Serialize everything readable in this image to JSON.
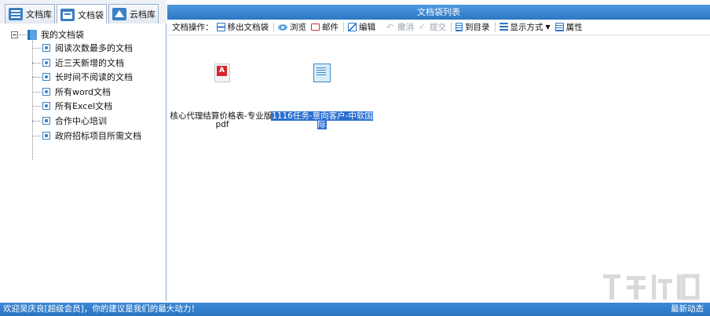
{
  "tabs": [
    {
      "label": "文档库",
      "icon": "list-icon",
      "active": false
    },
    {
      "label": "文档袋",
      "icon": "folder-icon",
      "active": true
    },
    {
      "label": "云档库",
      "icon": "cloud-icon",
      "active": false
    }
  ],
  "tree": {
    "root": "我的文档袋",
    "items": [
      {
        "label": "阅读次数最多的文档",
        "icon": "view-node-icon"
      },
      {
        "label": "近三天新增的文档",
        "icon": "view-node-icon"
      },
      {
        "label": "长时间不阅读的文档",
        "icon": "view-node-icon"
      },
      {
        "label": "所有word文档",
        "icon": "view-node-icon"
      },
      {
        "label": "所有Excel文档",
        "icon": "view-node-icon"
      },
      {
        "label": "合作中心培训",
        "icon": "person-node-icon"
      },
      {
        "label": "政府招标项目所需文档",
        "icon": "person-node-icon"
      }
    ]
  },
  "panel": {
    "title": "文档袋列表"
  },
  "toolbar": {
    "prefix": "文档操作：",
    "move_out": "移出文档袋",
    "browse": "浏览",
    "mail": "邮件",
    "edit": "编辑",
    "cancel": "撤消",
    "submit": "提交",
    "to_dir": "到目录",
    "display_mode": "显示方式",
    "properties": "属性"
  },
  "files": [
    {
      "name_line1": "核心代理结算价格表-专业版.",
      "name_line2": "pdf",
      "type": "pdf",
      "selected": false
    },
    {
      "name_line1": "1116任务-意向客户-中软国际",
      "name_line2": "",
      "type": "excel",
      "selected": true
    }
  ],
  "status": {
    "left": "欢迎吴庆良[超级会员]，你的建议是我们的最大动力！",
    "right": "最新动态"
  },
  "colors": {
    "accent": "#2c77c4",
    "selection": "#2b6fd1"
  }
}
